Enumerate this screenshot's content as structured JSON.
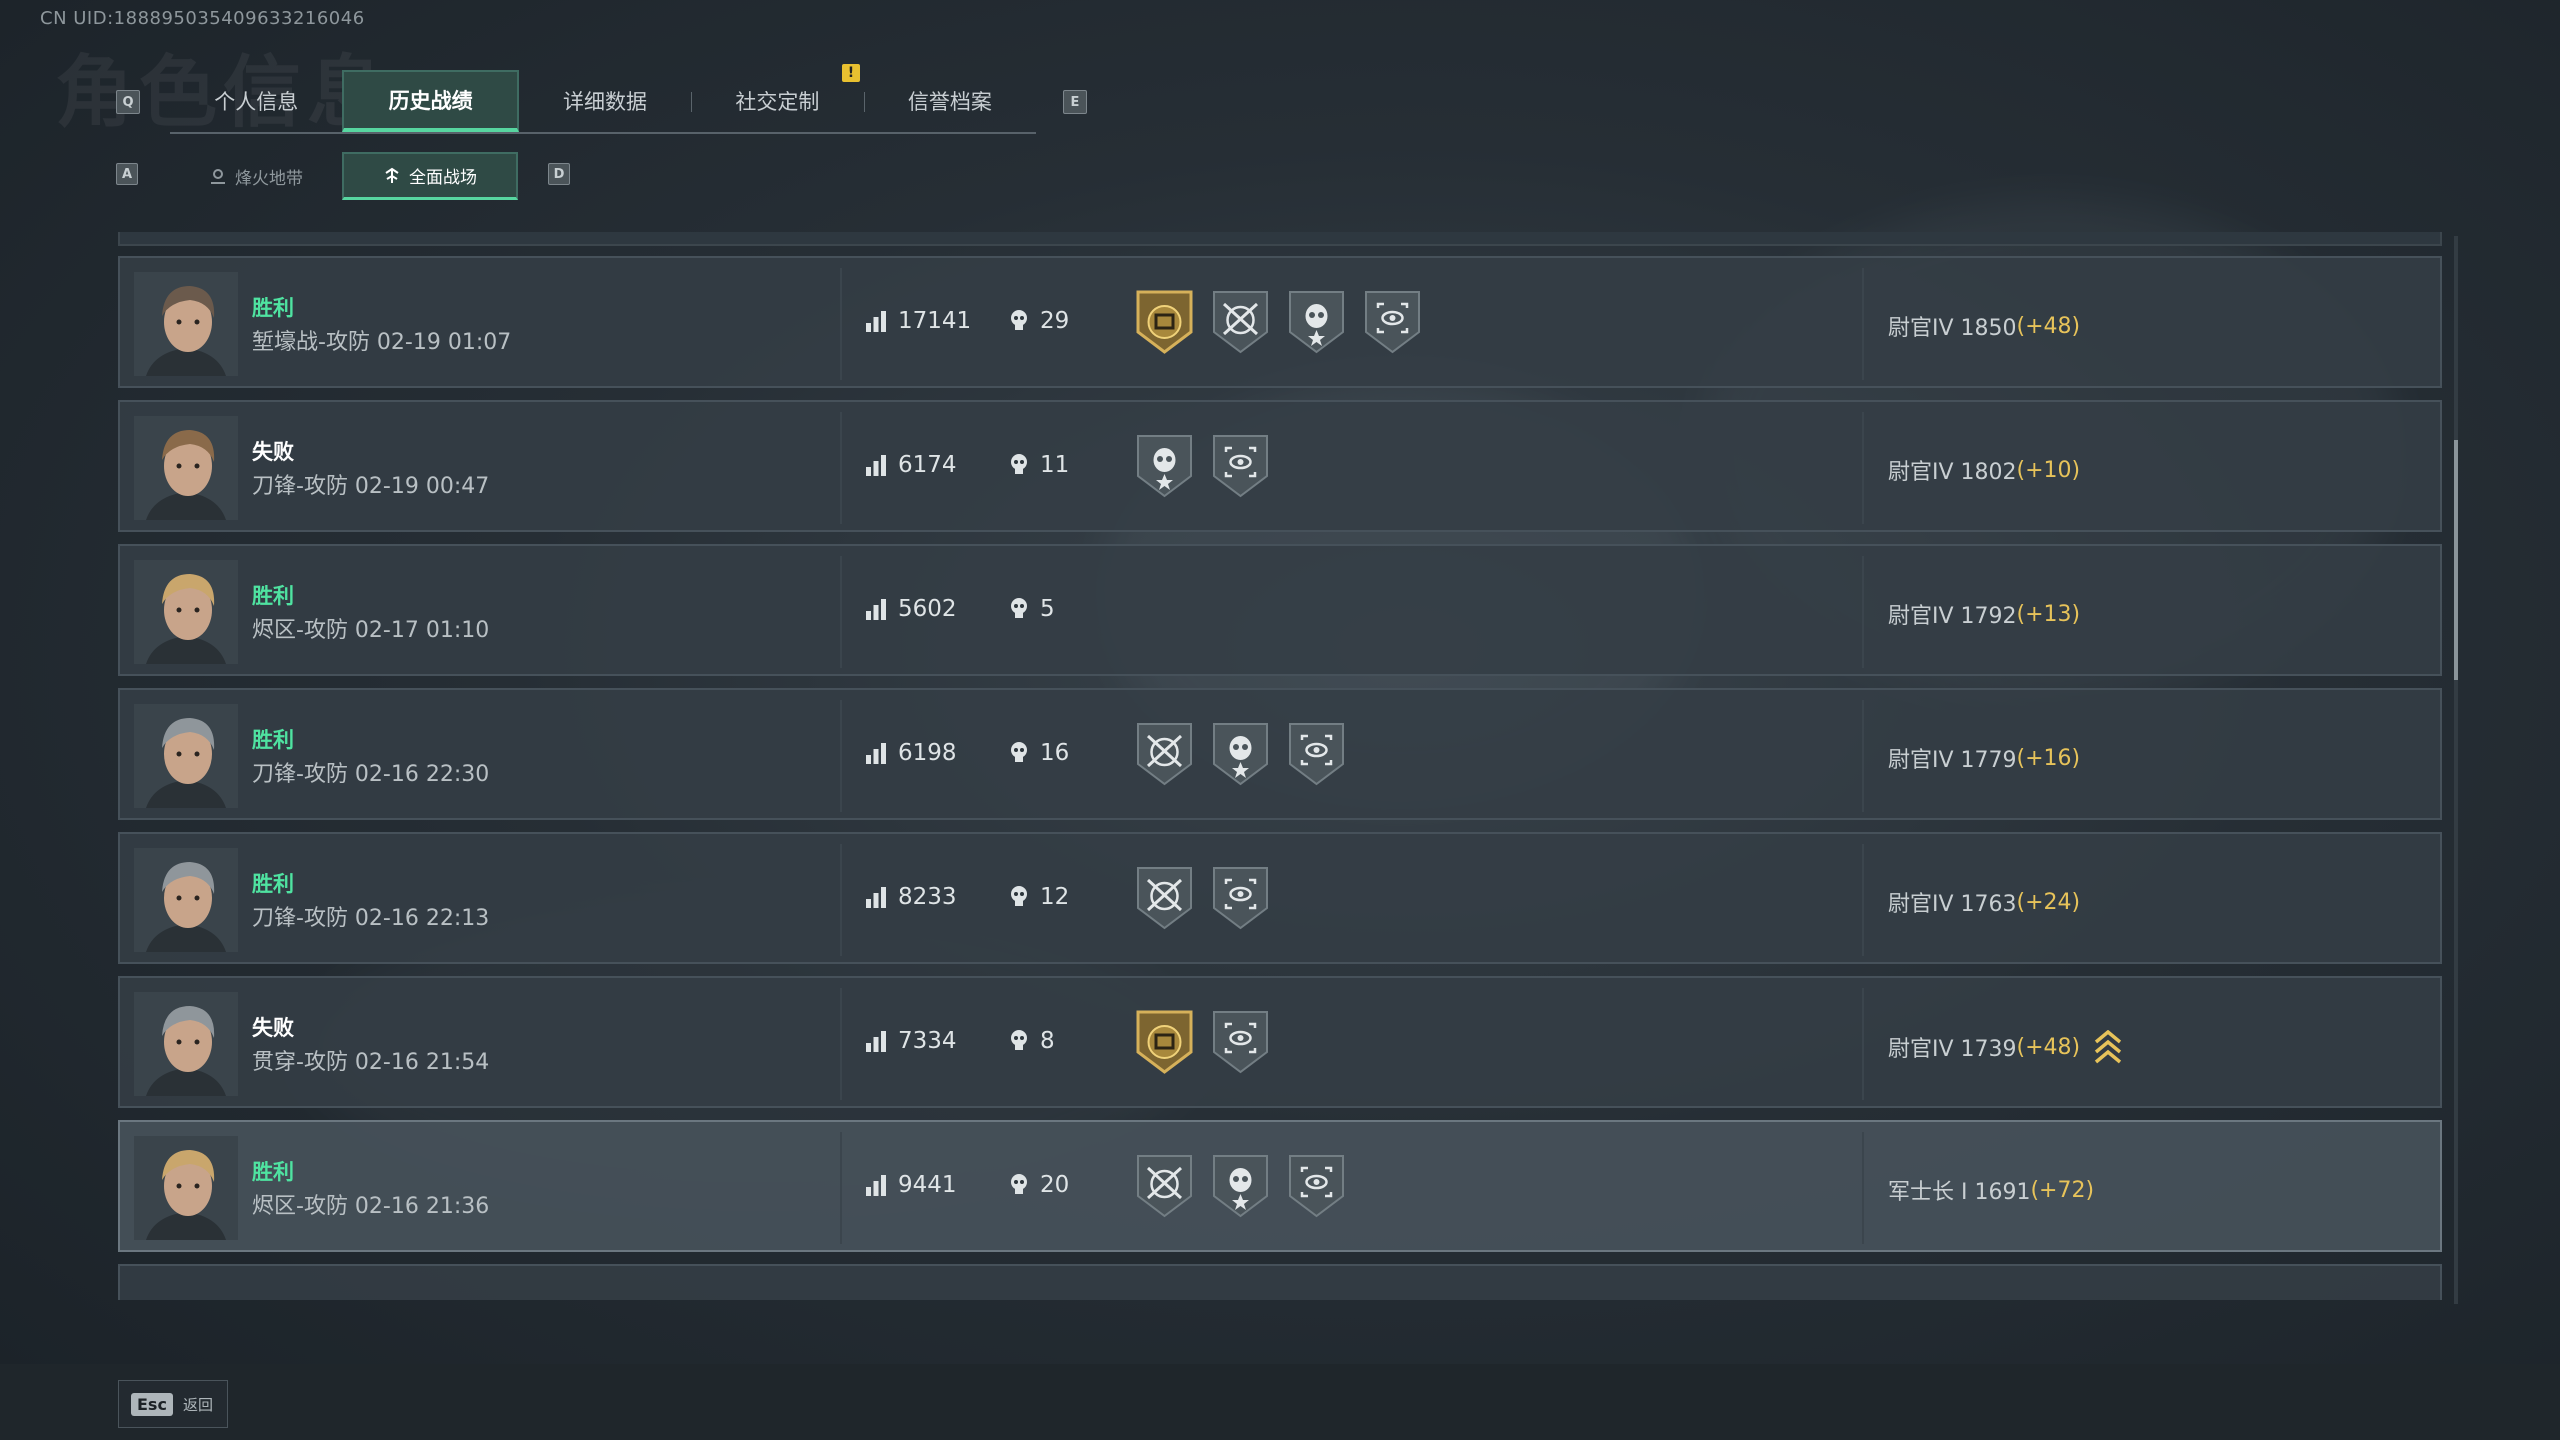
{
  "uid": "CN UID:1888950354096332160​46",
  "ghost_title": "角色信息",
  "keys": {
    "prev_tab": "Q",
    "next_tab": "E",
    "prev_sub": "A",
    "next_sub": "D"
  },
  "tabs": [
    {
      "label": "个人信息",
      "active": false
    },
    {
      "label": "历史战绩",
      "active": true
    },
    {
      "label": "详细数据",
      "active": false
    },
    {
      "label": "社交定制",
      "active": false
    },
    {
      "label": "信誉档案",
      "active": false
    }
  ],
  "notice_badge": "!",
  "subtabs": [
    {
      "label": "烽火地带",
      "active": false
    },
    {
      "label": "全面战场",
      "active": true
    }
  ],
  "matches": [
    {
      "result": "胜利",
      "outcome": "win",
      "detail": "堑壕战-攻防 02-19 01:07",
      "score": "17141",
      "kills": "29",
      "medals": [
        "gold-trophy",
        "crossed-rifle",
        "skull-star",
        "target-eye"
      ],
      "rank": "尉官IV 1850",
      "delta": "(+48)",
      "avatar_tone": "#6b5a4c",
      "rank_up": false,
      "highlight": false
    },
    {
      "result": "失败",
      "outcome": "lose",
      "detail": "刀锋-攻防 02-19 00:47",
      "score": "6174",
      "kills": "11",
      "medals": [
        "skull-star",
        "target-eye"
      ],
      "rank": "尉官IV 1802",
      "delta": "(+10)",
      "avatar_tone": "#8a6a4a",
      "rank_up": false,
      "highlight": false
    },
    {
      "result": "胜利",
      "outcome": "win",
      "detail": "烬区-攻防 02-17 01:10",
      "score": "5602",
      "kills": "5",
      "medals": [],
      "rank": "尉官IV 1792",
      "delta": "(+13)",
      "avatar_tone": "#c9a66c",
      "rank_up": false,
      "highlight": false
    },
    {
      "result": "胜利",
      "outcome": "win",
      "detail": "刀锋-攻防 02-16 22:30",
      "score": "6198",
      "kills": "16",
      "medals": [
        "crossed-rifle",
        "skull-star",
        "target-eye"
      ],
      "rank": "尉官IV 1779",
      "delta": "(+16)",
      "avatar_tone": "#8f969b",
      "rank_up": false,
      "highlight": false
    },
    {
      "result": "胜利",
      "outcome": "win",
      "detail": "刀锋-攻防 02-16 22:13",
      "score": "8233",
      "kills": "12",
      "medals": [
        "crossed-rifle",
        "target-eye"
      ],
      "rank": "尉官IV 1763",
      "delta": "(+24)",
      "avatar_tone": "#8f969b",
      "rank_up": false,
      "highlight": false
    },
    {
      "result": "失败",
      "outcome": "lose",
      "detail": "贯穿-攻防 02-16 21:54",
      "score": "7334",
      "kills": "8",
      "medals": [
        "gold-trophy",
        "target-eye"
      ],
      "rank": "尉官IV 1739",
      "delta": "(+48)",
      "avatar_tone": "#8f969b",
      "rank_up": true,
      "highlight": false
    },
    {
      "result": "胜利",
      "outcome": "win",
      "detail": "烬区-攻防 02-16 21:36",
      "score": "9441",
      "kills": "20",
      "medals": [
        "crossed-rifle",
        "skull-star",
        "target-eye"
      ],
      "rank": "军士长 I  1691",
      "delta": "(+72)",
      "avatar_tone": "#c9a66c",
      "rank_up": false,
      "highlight": true
    }
  ],
  "footer": {
    "esc_key": "Esc",
    "esc_label": "返回"
  }
}
